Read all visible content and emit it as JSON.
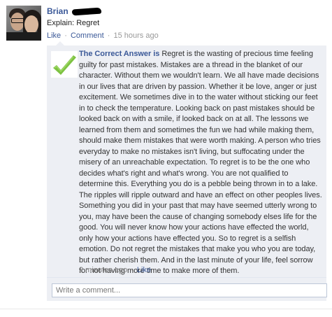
{
  "post": {
    "author": "Brian",
    "text": "Explain: Regret",
    "like_label": "Like",
    "comment_label": "Comment",
    "timestamp": "15 hours ago",
    "separator": "·"
  },
  "comment": {
    "author": "The Correct Answer is",
    "text": "Regret is the wasting of precious time feeling guilty for past mistakes. Mistakes are a thread in the blanket of our character. Without them we wouldn't learn. We all have made decisions in our lives that are driven by passion. Whether it be love, anger or just excitement. We sometimes dive in to the water without sticking our feet in to check the temperature. Looking back on past mistakes should be looked back on with a smile, if looked back on at all. The lessons we learned from them and sometimes the fun we had while making them, should make them mistakes that were worth making. A person who tries everyday to make no mistakes isn't living, but suffocating under the misery of an unreachable expectation. To regret is to be the one who decides what's right and what's wrong. You are not qualified to determine this. Everything you do is a pebble being thrown in to a lake. The ripples will ripple outward and have an effect on other peoples lives. Something you did in your past that may have seemed utterly wrong to you, may have been the cause of changing somebody elses life for the good. You will never know how your actions have effected the world, only how your actions have effected you. So to regret is a selfish emotion. Do not regret the mistakes that make you who you are today, but rather cherish them. And in the last minute of your life, feel sorrow for not having more time to make more of them.",
    "timestamp": "2 minutes ago",
    "like_label": "Like",
    "separator": "·"
  },
  "composer": {
    "placeholder": "Write a comment..."
  },
  "icons": {
    "avatar": "profile-photo-couple",
    "commenter_avatar": "green-checkmark-icon"
  },
  "colors": {
    "link": "#3b5998",
    "comment_bg": "#edeff4",
    "check_green": "#7dc242"
  }
}
